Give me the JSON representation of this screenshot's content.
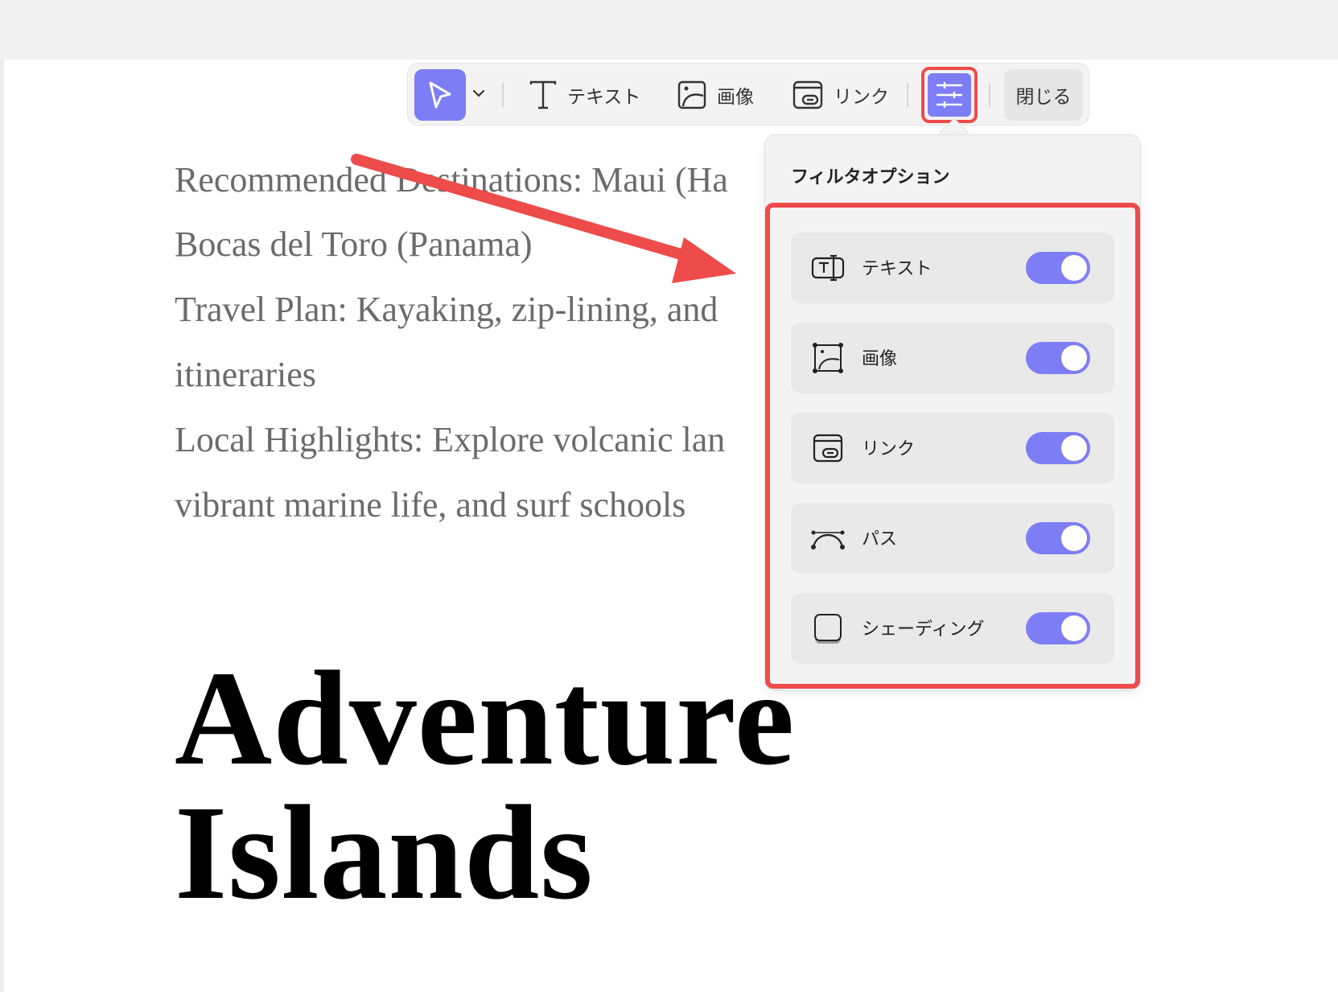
{
  "toolbar": {
    "text_label": "テキスト",
    "image_label": "画像",
    "link_label": "リンク",
    "close_label": "閉じる"
  },
  "document": {
    "lines": [
      "Recommended Destinations: Maui (Ha",
      "Bocas del Toro (Panama)",
      "Travel Plan: Kayaking, zip-lining, and",
      "itineraries",
      "Local Highlights: Explore volcanic lan",
      "vibrant marine life, and surf schools"
    ],
    "heading_line1": "Adventure",
    "heading_line2": "Islands"
  },
  "filter_popup": {
    "title": "フィルタオプション",
    "options": [
      {
        "label": "テキスト",
        "icon": "text-box-icon",
        "enabled": true
      },
      {
        "label": "画像",
        "icon": "image-icon",
        "enabled": true
      },
      {
        "label": "リンク",
        "icon": "link-icon",
        "enabled": true
      },
      {
        "label": "パス",
        "icon": "path-icon",
        "enabled": true
      },
      {
        "label": "シェーディング",
        "icon": "shading-icon",
        "enabled": true
      }
    ]
  },
  "colors": {
    "accent": "#7d7ef5",
    "highlight": "#ee4b4b",
    "toolbar_bg": "#f3f3f3",
    "body_text": "#6b6b6b"
  }
}
